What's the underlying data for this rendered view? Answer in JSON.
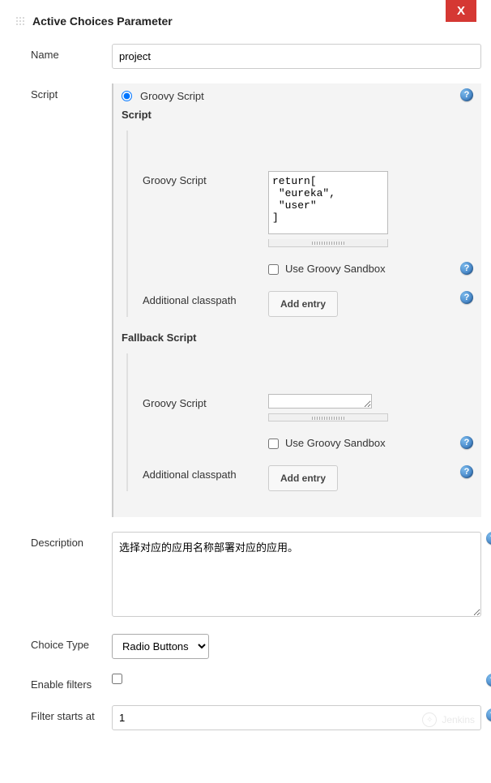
{
  "closeLabel": "X",
  "title": "Active Choices Parameter",
  "fields": {
    "name": {
      "label": "Name",
      "value": "project"
    },
    "script": {
      "label": "Script",
      "radioLabel": "Groovy Script",
      "scriptSection": "Script",
      "fallbackSection": "Fallback Script",
      "main": {
        "groovyLabel": "Groovy Script",
        "code": "return[\n \"eureka\",\n \"user\"\n]",
        "sandboxLabel": "Use Groovy Sandbox",
        "classpathLabel": "Additional classpath",
        "addEntryLabel": "Add entry"
      },
      "fallback": {
        "groovyLabel": "Groovy Script",
        "code": "",
        "sandboxLabel": "Use Groovy Sandbox",
        "classpathLabel": "Additional classpath",
        "addEntryLabel": "Add entry"
      }
    },
    "description": {
      "label": "Description",
      "value": "选择对应的应用名称部署对应的应用。"
    },
    "choiceType": {
      "label": "Choice Type",
      "value": "Radio Buttons"
    },
    "enableFilters": {
      "label": "Enable filters",
      "checked": false
    },
    "filterStartsAt": {
      "label": "Filter starts at",
      "value": "1"
    }
  },
  "watermark": "Jenkins"
}
